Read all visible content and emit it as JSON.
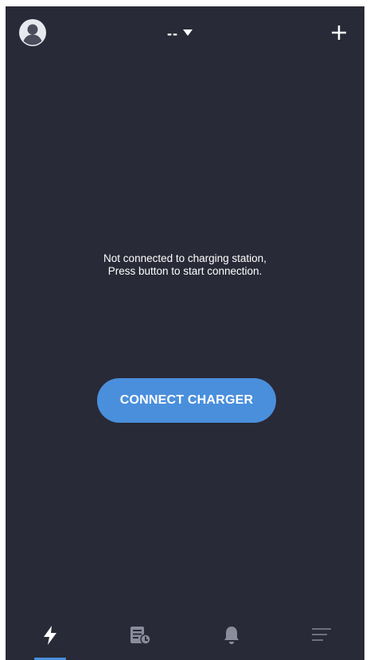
{
  "header": {
    "avatar_icon": "account-circle-icon",
    "device_selector": {
      "value": "--",
      "icon": "caret-down-icon"
    },
    "add_icon": "plus-icon"
  },
  "main": {
    "message_line1": "Not connected to charging station,",
    "message_line2": "Press button to start connection.",
    "connect_button_label": "CONNECT CHARGER"
  },
  "bottom_nav": {
    "items": [
      {
        "icon": "lightning-bolt-icon",
        "active": true
      },
      {
        "icon": "receipt-list-icon",
        "active": false
      },
      {
        "icon": "bell-icon",
        "active": false
      },
      {
        "icon": "menu-lines-icon",
        "active": false
      }
    ]
  },
  "colors": {
    "background": "#292a37",
    "accent": "#4a8fdc",
    "icon_inactive": "#8a8c9c",
    "text": "#ffffff"
  }
}
